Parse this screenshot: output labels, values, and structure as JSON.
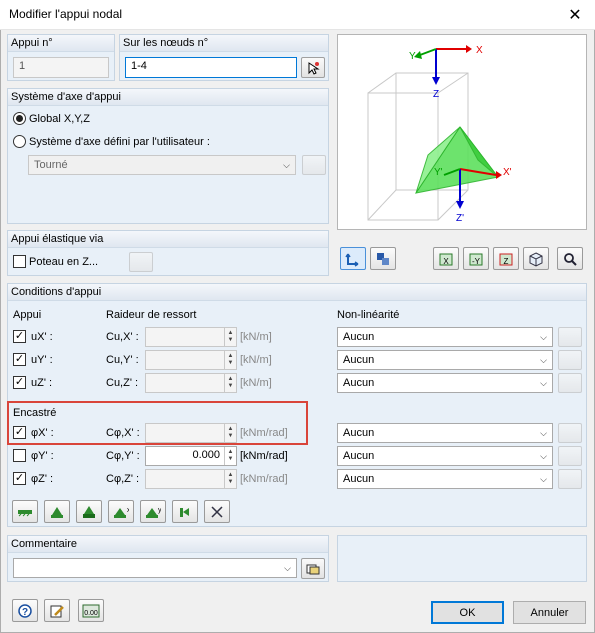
{
  "window": {
    "title": "Modifier l'appui nodal",
    "close": "✕"
  },
  "appui": {
    "header": "Appui n°",
    "value": "1"
  },
  "noeuds": {
    "header": "Sur les nœuds n°",
    "value": "1-4"
  },
  "systeme": {
    "header": "Système d'axe d'appui",
    "global_label": "Global X,Y,Z",
    "user_label": "Système d'axe défini par l'utilisateur :",
    "select_value": "Tourné",
    "selected": "global"
  },
  "preview": {
    "labels": {
      "y": "Y",
      "x": "X",
      "z": "Z",
      "yp": "Y'",
      "xp": "X'",
      "zp": "Z'"
    }
  },
  "elastique": {
    "header": "Appui élastique via",
    "poteau_label": "Poteau en Z...",
    "poteau_checked": false
  },
  "conditions": {
    "header": "Conditions d'appui",
    "col_appui": "Appui",
    "col_raideur": "Raideur de ressort",
    "col_nonlin": "Non-linéarité",
    "encastre_label": "Encastré",
    "rows": [
      {
        "label": "uX' :",
        "checked": true,
        "cname": "Cu,X' :",
        "value": "",
        "unit": "[kN/m]",
        "enabled": false,
        "nonlin": "Aucun"
      },
      {
        "label": "uY' :",
        "checked": true,
        "cname": "Cu,Y' :",
        "value": "",
        "unit": "[kN/m]",
        "enabled": false,
        "nonlin": "Aucun"
      },
      {
        "label": "uZ' :",
        "checked": true,
        "cname": "Cu,Z' :",
        "value": "",
        "unit": "[kN/m]",
        "enabled": false,
        "nonlin": "Aucun"
      },
      {
        "label": "φX' :",
        "checked": true,
        "cname": "Cφ,X' :",
        "value": "",
        "unit": "[kNm/rad]",
        "enabled": false,
        "nonlin": "Aucun"
      },
      {
        "label": "φY' :",
        "checked": false,
        "cname": "Cφ,Y' :",
        "value": "0.000",
        "unit": "[kNm/rad]",
        "enabled": true,
        "nonlin": "Aucun"
      },
      {
        "label": "φZ' :",
        "checked": true,
        "cname": "Cφ,Z' :",
        "value": "",
        "unit": "[kNm/rad]",
        "enabled": false,
        "nonlin": "Aucun"
      }
    ]
  },
  "commentaire": {
    "header": "Commentaire",
    "value": ""
  },
  "buttons": {
    "ok": "OK",
    "cancel": "Annuler"
  },
  "colors": {
    "highlight": "#d9453a",
    "accent": "#0078d7",
    "green": "#22c422"
  }
}
